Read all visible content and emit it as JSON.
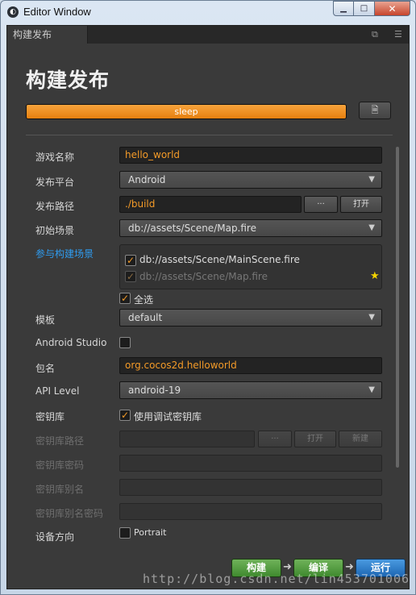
{
  "window": {
    "title": "Editor Window",
    "minimize": "▁",
    "maximize": "□",
    "close": "✕"
  },
  "tab": {
    "label": "构建发布"
  },
  "header": {
    "title": "构建发布",
    "progress_label": "sleep",
    "progress_value": 1.0
  },
  "form": {
    "game_name": {
      "label": "游戏名称",
      "value": "hello_world"
    },
    "platform": {
      "label": "发布平台",
      "value": "Android"
    },
    "build_path": {
      "label": "发布路径",
      "value": "./build",
      "browse_label": "···",
      "open_label": "打开"
    },
    "start_scene": {
      "label": "初始场景",
      "value": "db://assets/Scene/Map.fire"
    },
    "build_scenes": {
      "label": "参与构建场景",
      "items": [
        {
          "path": "db://assets/Scene/MainScene.fire",
          "checked": true
        },
        {
          "path": "db://assets/Scene/Map.fire",
          "checked": true
        }
      ],
      "select_all_label": "全选"
    },
    "template": {
      "label": "模板",
      "value": "default"
    },
    "android_studio": {
      "label": "Android Studio",
      "checked": false
    },
    "package_name": {
      "label": "包名",
      "value": "org.cocos2d.helloworld"
    },
    "api_level": {
      "label": "API Level",
      "value": "android-19"
    },
    "keystore": {
      "label": "密钥库",
      "debug_label": "使用调试密钥库",
      "checked": true
    },
    "keystore_path": {
      "label": "密钥库路径",
      "browse_label": "···",
      "open_label": "打开",
      "new_label": "新建"
    },
    "keystore_password": {
      "label": "密钥库密码"
    },
    "keystore_alias": {
      "label": "密钥库别名"
    },
    "keystore_alias_password": {
      "label": "密钥库别名密码"
    },
    "orientation": {
      "label": "设备方向",
      "portrait_label": "Portrait"
    }
  },
  "actions": {
    "build": "构建",
    "compile": "编译",
    "run": "运行",
    "arrow": "➜"
  },
  "watermark": "http://blog.csdn.net/lin453701006",
  "colors": {
    "accent": "#f39a28",
    "link": "#2f9cf0",
    "panel": "#3a3a3a",
    "build": "#4f9a3c",
    "run": "#2a7acb"
  }
}
